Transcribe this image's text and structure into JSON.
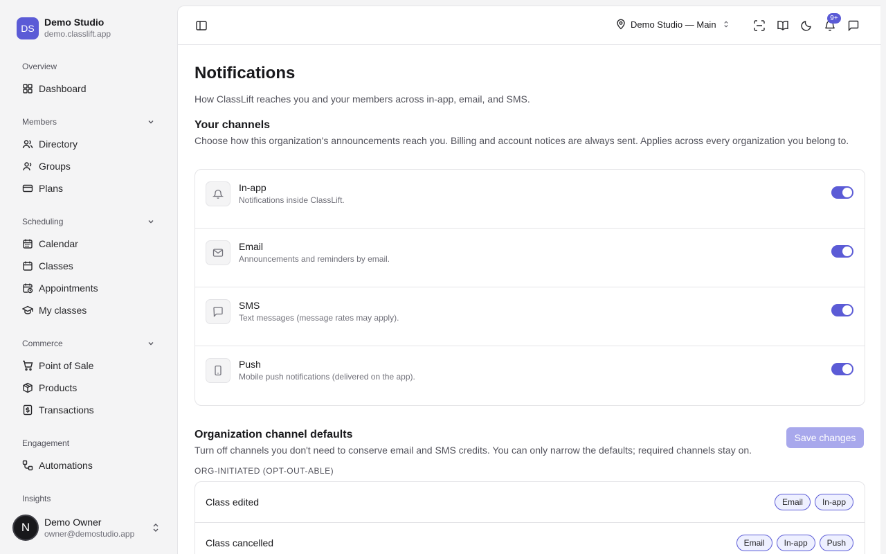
{
  "org": {
    "initials": "DS",
    "name": "Demo Studio",
    "domain": "demo.classlift.app"
  },
  "sidebar": {
    "overview_label": "Overview",
    "dashboard": "Dashboard",
    "members_label": "Members",
    "directory": "Directory",
    "groups": "Groups",
    "plans": "Plans",
    "scheduling_label": "Scheduling",
    "calendar": "Calendar",
    "classes": "Classes",
    "appointments": "Appointments",
    "my_classes": "My classes",
    "commerce_label": "Commerce",
    "point_of_sale": "Point of Sale",
    "products": "Products",
    "transactions": "Transactions",
    "engagement_label": "Engagement",
    "automations": "Automations",
    "insights_label": "Insights"
  },
  "user": {
    "initial": "N",
    "name": "Demo Owner",
    "email": "owner@demostudio.app"
  },
  "topbar": {
    "location": "Demo Studio — Main",
    "notification_count": "9+"
  },
  "page": {
    "title": "Notifications",
    "subtitle": "How ClassLift reaches you and your members across in-app, email, and SMS."
  },
  "channels": {
    "title": "Your channels",
    "description": "Choose how this organization's announcements reach you. Billing and account notices are always sent. Applies across every organization you belong to.",
    "items": [
      {
        "title": "In-app",
        "description": "Notifications inside ClassLift.",
        "icon": "bell-icon",
        "enabled": true
      },
      {
        "title": "Email",
        "description": "Announcements and reminders by email.",
        "icon": "mail-icon",
        "enabled": true
      },
      {
        "title": "SMS",
        "description": "Text messages (message rates may apply).",
        "icon": "message-icon",
        "enabled": true
      },
      {
        "title": "Push",
        "description": "Mobile push notifications (delivered on the app).",
        "icon": "smartphone-icon",
        "enabled": true
      }
    ]
  },
  "defaults": {
    "title": "Organization channel defaults",
    "description": "Turn off channels you don't need to conserve email and SMS credits. You can only narrow the defaults; required channels stay on.",
    "save_label": "Save changes",
    "group_label": "ORG-INITIATED (OPT-OUT-ABLE)",
    "rows": [
      {
        "title": "Class edited",
        "chips": [
          "Email",
          "In-app"
        ]
      },
      {
        "title": "Class cancelled",
        "chips": [
          "Email",
          "In-app",
          "Push"
        ]
      }
    ]
  },
  "colors": {
    "accent": "#5b5bd6",
    "accent_disabled": "#a8a8ec"
  }
}
